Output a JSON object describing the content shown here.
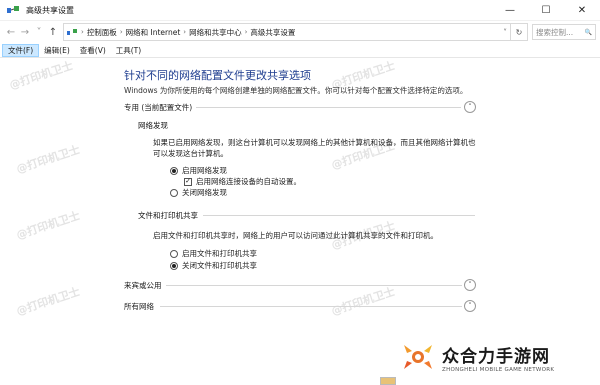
{
  "window": {
    "title": "高级共享设置",
    "icon": "network-icon",
    "controls": [
      "—",
      "☐",
      "✕"
    ]
  },
  "address_bar": {
    "back": "←",
    "forward": "→",
    "recent": "˅",
    "up": "↑",
    "crumbs": [
      "控制面板",
      "网络和 Internet",
      "网络和共享中心",
      "高级共享设置"
    ],
    "separator": "›",
    "dropdown": "˅",
    "refresh": "↻",
    "search_placeholder": "搜索控制...",
    "search_icon": "🔍"
  },
  "menu": {
    "items": [
      "文件(F)",
      "编辑(E)",
      "查看(V)",
      "工具(T)"
    ]
  },
  "main": {
    "heading": "针对不同的网络配置文件更改共享选项",
    "description": "Windows 为你所使用的每个网络创建单独的网络配置文件。你可以针对每个配置文件选择特定的选项。",
    "profile_private": {
      "title": "专用 (当前配置文件)",
      "chevron": "˄",
      "network_discovery": {
        "title": "网络发现",
        "paragraph_line1": "如果已启用网络发现，则这台计算机可以发现网络上的其他计算机和设备，而且其他网络计算机也",
        "paragraph_line2": "可以发现这台计算机。",
        "option_on": "启用网络发现",
        "option_auto": "启用网络连接设备的自动设置。",
        "option_off": "关闭网络发现"
      },
      "file_printer": {
        "title": "文件和打印机共享",
        "paragraph": "启用文件和打印机共享时，网络上的用户可以访问通过此计算机共享的文件和打印机。",
        "option_on": "启用文件和打印机共享",
        "option_off": "关闭文件和打印机共享"
      }
    },
    "profile_guest": {
      "title": "来宾或公用",
      "chevron": "˅"
    },
    "profile_all": {
      "title": "所有网络",
      "chevron": "˅"
    }
  },
  "watermark_text": "@打印机卫士",
  "brand": {
    "name": "众合力手游网",
    "subtitle": "ZHONGHELI MOBILE GAME NETWORK"
  }
}
